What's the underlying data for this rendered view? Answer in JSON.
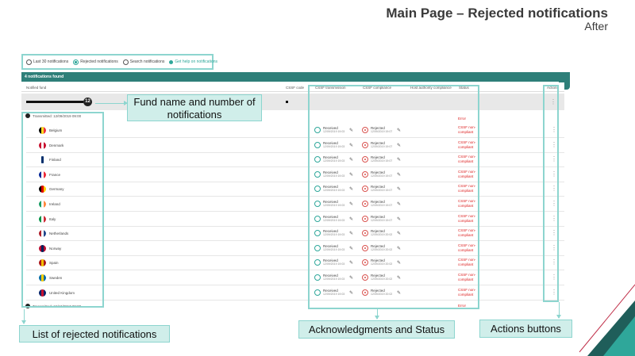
{
  "slide": {
    "title": "Main Page – Rejected notifications",
    "subtitle": "After"
  },
  "filters": {
    "last30": "Last 30 notifications",
    "rejected": "Rejected notifications",
    "search": "Search notifications",
    "help_link": "Get help on notifications"
  },
  "panel": {
    "count_label": "4 notifications found"
  },
  "columns": {
    "notified_fund": "Notified fund",
    "cssf_code": "CSSF code",
    "cssf_transmission": "CSSF transmission",
    "cssf_compliance": "CSSF compliance",
    "host_authority": "Host authority compliance",
    "status": "Status",
    "actions": "Actions"
  },
  "fund": {
    "count": "12"
  },
  "groups": [
    {
      "transmitted": "Transmitted: 12/09/2019 09:00",
      "status": "Error"
    },
    {
      "transmitted": "Transmitted: 15/10/2017 09:00",
      "status": "Error"
    }
  ],
  "rows": [
    {
      "country": "Belgium",
      "flag": [
        "#000000",
        "#FDDA24",
        "#EF3340"
      ],
      "ack": "Received",
      "ack_date": "12/09/2019 19:03",
      "comp": "Rejected",
      "comp_date": "12/09/2019 19:07",
      "status": "CSSF non-compliant"
    },
    {
      "country": "Denmark",
      "flag": [
        "#C8102E",
        "#ffffff",
        "#C8102E"
      ],
      "ack": "Received",
      "ack_date": "12/09/2019 19:03",
      "comp": "Rejected",
      "comp_date": "12/09/2019 19:07",
      "status": "CSSF non-compliant"
    },
    {
      "country": "Finland",
      "flag": [
        "#ffffff",
        "#002F6C",
        "#ffffff"
      ],
      "ack": "Received",
      "ack_date": "12/09/2019 19:03",
      "comp": "Rejected",
      "comp_date": "12/09/2019 19:07",
      "status": "CSSF non-compliant"
    },
    {
      "country": "France",
      "flag": [
        "#002395",
        "#ffffff",
        "#ED2939"
      ],
      "ack": "Received",
      "ack_date": "12/09/2019 19:03",
      "comp": "Rejected",
      "comp_date": "12/09/2019 19:07",
      "status": "CSSF non-compliant"
    },
    {
      "country": "Germany",
      "flag": [
        "#000000",
        "#DD0000",
        "#FFCE00"
      ],
      "ack": "Received",
      "ack_date": "12/09/2019 19:03",
      "comp": "Rejected",
      "comp_date": "12/09/2019 19:07",
      "status": "CSSF non-compliant"
    },
    {
      "country": "Ireland",
      "flag": [
        "#169B62",
        "#ffffff",
        "#FF883E"
      ],
      "ack": "Received",
      "ack_date": "12/09/2019 19:03",
      "comp": "Rejected",
      "comp_date": "12/09/2019 19:07",
      "status": "CSSF non-compliant"
    },
    {
      "country": "Italy",
      "flag": [
        "#009246",
        "#ffffff",
        "#CE2B37"
      ],
      "ack": "Received",
      "ack_date": "12/09/2019 19:03",
      "comp": "Rejected",
      "comp_date": "12/09/2019 19:07",
      "status": "CSSF non-compliant"
    },
    {
      "country": "Netherlands",
      "flag": [
        "#AE1C28",
        "#ffffff",
        "#21468B"
      ],
      "ack": "Received",
      "ack_date": "12/09/2019 19:03",
      "comp": "Rejected",
      "comp_date": "12/09/2019 20:02",
      "status": "CSSF non-compliant"
    },
    {
      "country": "Norway",
      "flag": [
        "#BA0C2F",
        "#00205B",
        "#BA0C2F"
      ],
      "ack": "Received",
      "ack_date": "12/09/2019 19:03",
      "comp": "Rejected",
      "comp_date": "12/09/2019 20:02",
      "status": "CSSF non-compliant"
    },
    {
      "country": "Spain",
      "flag": [
        "#AA151B",
        "#F1BF00",
        "#AA151B"
      ],
      "ack": "Received",
      "ack_date": "12/09/2019 19:03",
      "comp": "Rejected",
      "comp_date": "12/09/2019 20:02",
      "status": "CSSF non-compliant"
    },
    {
      "country": "Sweden",
      "flag": [
        "#006AA7",
        "#FECC00",
        "#006AA7"
      ],
      "ack": "Received",
      "ack_date": "12/09/2019 19:03",
      "comp": "Rejected",
      "comp_date": "12/09/2019 20:02",
      "status": "CSSF non-compliant"
    },
    {
      "country": "United Kingdom",
      "flag": [
        "#012169",
        "#C8102E",
        "#012169"
      ],
      "ack": "Received",
      "ack_date": "12/09/2019 19:03",
      "comp": "Rejected",
      "comp_date": "12/09/2019 20:02",
      "status": "CSSF non-compliant"
    }
  ],
  "callouts": {
    "fund": "Fund name and number of notifications",
    "list": "List of rejected notifications",
    "ack": "Acknowledgments and Status",
    "actions": "Actions buttons"
  },
  "colors": {
    "accent": "#2fa79a",
    "panel": "#2e7f79",
    "highlight": "#8dd5cf",
    "callout_bg": "#d0eeea",
    "error": "#dd2222"
  }
}
